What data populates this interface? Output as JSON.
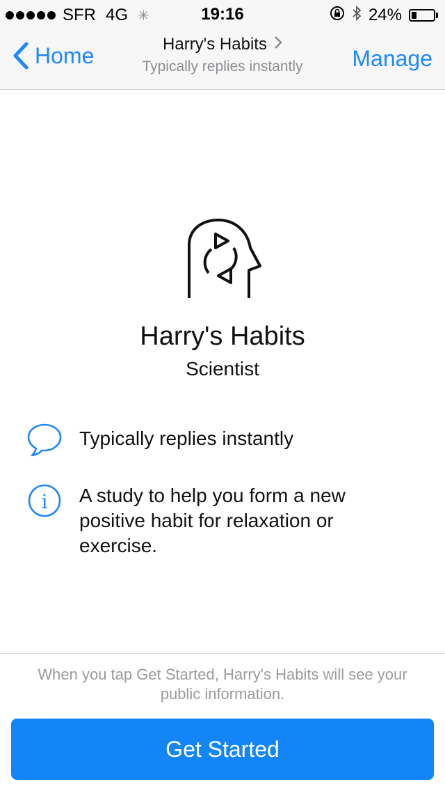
{
  "status_bar": {
    "carrier": "SFR",
    "network": "4G",
    "time": "19:16",
    "battery": "24%",
    "battery_level": 0.24,
    "icons": [
      "signal-dots-icon",
      "activity-spinner-icon",
      "rotation-lock-icon",
      "bluetooth-icon",
      "battery-icon"
    ]
  },
  "nav": {
    "back_label": "Home",
    "title": "Harry's Habits",
    "subtitle": "Typically replies instantly",
    "action_label": "Manage"
  },
  "profile": {
    "name": "Harry's Habits",
    "category": "Scientist",
    "icon": "head-refresh-icon"
  },
  "info": [
    {
      "icon": "speech-bubble-icon",
      "text": "Typically replies instantly"
    },
    {
      "icon": "info-icon",
      "text": "A study to help you form a new positive habit for relaxation or exercise."
    }
  ],
  "footer": {
    "disclaimer": "When you tap Get Started, Harry's Habits will see your public information.",
    "button_label": "Get Started"
  },
  "colors": {
    "accent": "#1e88ff",
    "button": "#1485f7",
    "secondary_text": "#8e8e93"
  }
}
